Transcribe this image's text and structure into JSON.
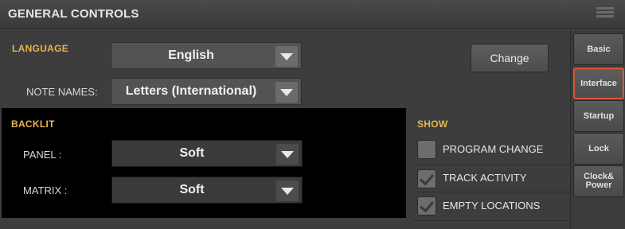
{
  "header": {
    "title": "GENERAL CONTROLS",
    "menu_icon": "hamburger-menu-icon"
  },
  "language": {
    "section_label": "LANGUAGE",
    "language_value": "English",
    "note_names_label": "NOTE NAMES:",
    "note_names_value": "Letters (International)",
    "change_button": "Change"
  },
  "backlit": {
    "section_label": "BACKLIT",
    "panel_label": "PANEL :",
    "panel_value": "Soft",
    "matrix_label": "MATRIX :",
    "matrix_value": "Soft"
  },
  "show": {
    "section_label": "SHOW",
    "items": [
      {
        "label": "PROGRAM CHANGE",
        "checked": false
      },
      {
        "label": "TRACK ACTIVITY",
        "checked": true
      },
      {
        "label": "EMPTY LOCATIONS",
        "checked": true
      }
    ]
  },
  "tabs": [
    {
      "label": "Basic",
      "active": false
    },
    {
      "label": "Interface",
      "active": true
    },
    {
      "label": "Startup",
      "active": false
    },
    {
      "label": "Lock",
      "active": false
    },
    {
      "label": "Clock& Power",
      "active": false
    }
  ],
  "colors": {
    "accent": "#e8b44a",
    "active_tab_border": "#d7583a"
  }
}
